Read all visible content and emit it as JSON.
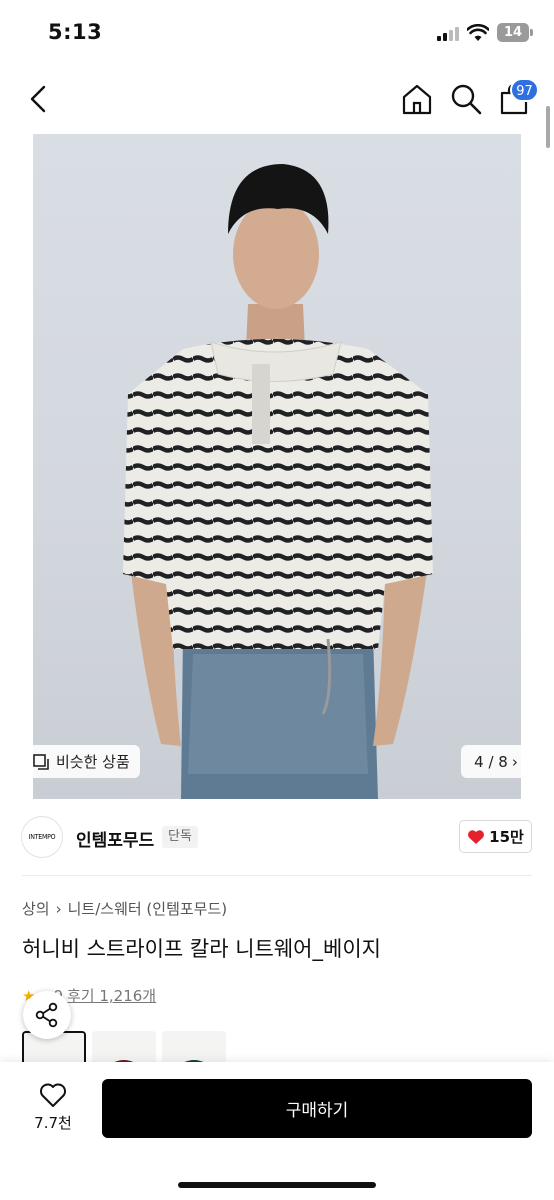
{
  "status_bar": {
    "time": "5:13",
    "battery": "14"
  },
  "nav": {
    "cart_count": "97"
  },
  "hero": {
    "similar_label": "비슷한 상품",
    "page_counter": "4 / 8"
  },
  "brand": {
    "logo_text": "INTEMPO",
    "name": "인템포무드",
    "tag": "단독",
    "likes": "15만"
  },
  "product": {
    "breadcrumb": [
      "상의",
      "니트/스웨터 (인템포무드)"
    ],
    "title": "허니비 스트라이프 칼라 니트웨어_베이지",
    "rating_partial": "9",
    "reviews": "후기 1,216개"
  },
  "swatches": [
    {
      "color": "#cdc7bc",
      "name": "beige"
    },
    {
      "color": "#6b1a22",
      "name": "burgundy"
    },
    {
      "color": "#14423a",
      "name": "green"
    }
  ],
  "bottom_bar": {
    "wish_count": "7.7천",
    "buy_label": "구매하기"
  },
  "colors": {
    "accent_blue": "#2f6fdf",
    "heart_red": "#e4212c",
    "buy_button": "#000000"
  }
}
